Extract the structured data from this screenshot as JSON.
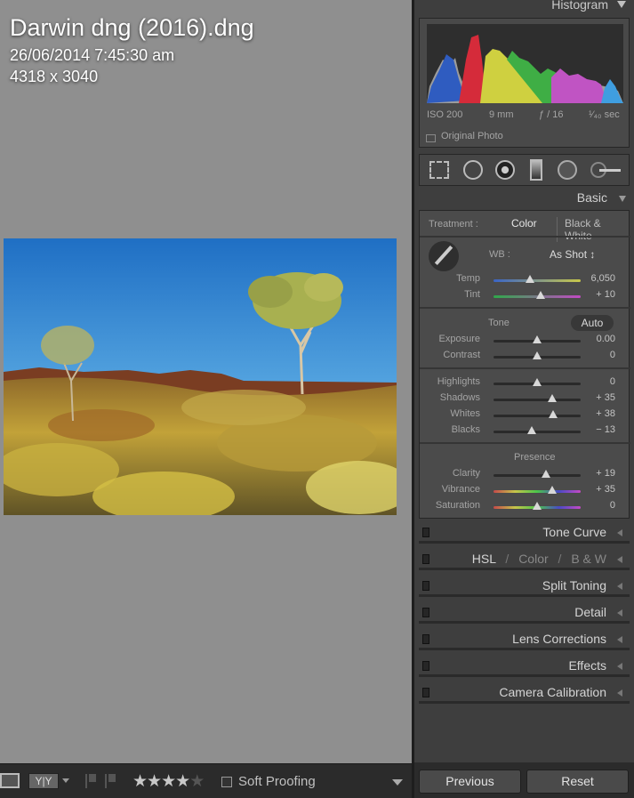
{
  "photo_info": {
    "filename": "Darwin dng (2016).dng",
    "datetime": "26/06/2014 7:45:30 am",
    "dimensions": "4318 x 3040"
  },
  "histogram": {
    "title": "Histogram",
    "iso": "ISO 200",
    "focal": "9 mm",
    "aperture": "ƒ / 16",
    "shutter": "¹⁄₄₀ sec",
    "original_photo": "Original Photo"
  },
  "tools": [
    "crop-overlay-icon",
    "spot-removal-icon",
    "red-eye-icon",
    "graduated-filter-icon",
    "radial-filter-icon",
    "adjustment-brush-icon"
  ],
  "basic": {
    "title": "Basic",
    "treatment_label": "Treatment :",
    "color": "Color",
    "bw": "Black & White",
    "wb_label": "WB :",
    "wb_value": "As Shot ↕",
    "tone_label": "Tone",
    "auto": "Auto",
    "presence_label": "Presence",
    "sliders": [
      {
        "name": "Temp",
        "value": "6,050",
        "pos": 0.42
      },
      {
        "name": "Tint",
        "value": "+ 10",
        "pos": 0.54
      },
      {
        "name": "Exposure",
        "value": "0.00",
        "pos": 0.5
      },
      {
        "name": "Contrast",
        "value": "0",
        "pos": 0.5
      },
      {
        "name": "Highlights",
        "value": "0",
        "pos": 0.5
      },
      {
        "name": "Shadows",
        "value": "+ 35",
        "pos": 0.67
      },
      {
        "name": "Whites",
        "value": "+ 38",
        "pos": 0.68
      },
      {
        "name": "Blacks",
        "value": "− 13",
        "pos": 0.44
      },
      {
        "name": "Clarity",
        "value": "+ 19",
        "pos": 0.6
      },
      {
        "name": "Vibrance",
        "value": "+ 35",
        "pos": 0.67
      },
      {
        "name": "Saturation",
        "value": "0",
        "pos": 0.5
      }
    ]
  },
  "panels": {
    "tone_curve": "Tone Curve",
    "hsl": "HSL",
    "hsl_sep1": "/",
    "hsl_color": "Color",
    "hsl_sep2": "/",
    "hsl_bw": "B & W",
    "split_toning": "Split Toning",
    "detail": "Detail",
    "lens_corrections": "Lens Corrections",
    "effects": "Effects",
    "camera_calibration": "Camera Calibration"
  },
  "toolbar": {
    "soft_proofing": "Soft Proofing",
    "rating": 4,
    "rating_max": 5
  },
  "buttons": {
    "previous": "Previous",
    "reset": "Reset"
  }
}
